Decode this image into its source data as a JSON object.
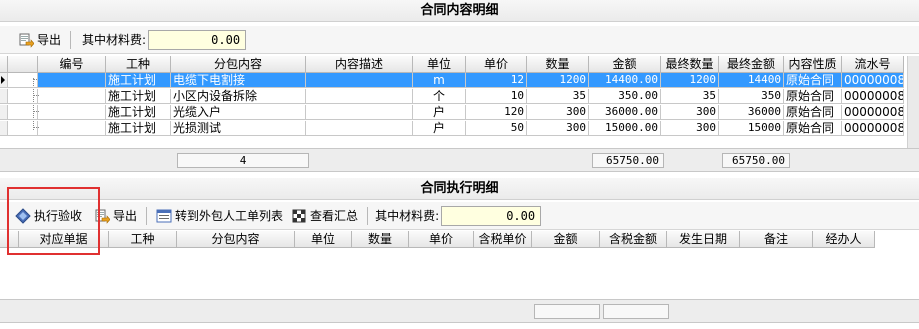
{
  "contract": {
    "title": "合同内容明细",
    "toolbar": {
      "export_label": "导出",
      "material_fee_label": "其中材料费:",
      "material_fee_value": "0.00"
    },
    "columns": [
      "编号",
      "工种",
      "分包内容",
      "内容描述",
      "单位",
      "单价",
      "数量",
      "金额",
      "最终数量",
      "最终金额",
      "内容性质",
      "流水号"
    ],
    "rows": [
      {
        "code": "",
        "trade": "施工计划",
        "content": "电缆下电割接",
        "desc": "",
        "unit": "m",
        "price": "12",
        "qty": "1200",
        "amount": "14400.00",
        "final_qty": "1200",
        "final_amount": "14400",
        "nature": "原始合同",
        "serial": "00000008"
      },
      {
        "code": "",
        "trade": "施工计划",
        "content": "小区内设备拆除",
        "desc": "",
        "unit": "个",
        "price": "10",
        "qty": "35",
        "amount": "350.00",
        "final_qty": "35",
        "final_amount": "350",
        "nature": "原始合同",
        "serial": "00000008"
      },
      {
        "code": "",
        "trade": "施工计划",
        "content": "光缆入户",
        "desc": "",
        "unit": "户",
        "price": "120",
        "qty": "300",
        "amount": "36000.00",
        "final_qty": "300",
        "final_amount": "36000",
        "nature": "原始合同",
        "serial": "00000008"
      },
      {
        "code": "",
        "trade": "施工计划",
        "content": "光损测试",
        "desc": "",
        "unit": "户",
        "price": "50",
        "qty": "300",
        "amount": "15000.00",
        "final_qty": "300",
        "final_amount": "15000",
        "nature": "原始合同",
        "serial": "00000008"
      }
    ],
    "footer": {
      "count": "4",
      "amount_total": "65750.00",
      "final_amount_total": "65750.00"
    }
  },
  "execution": {
    "title": "合同执行明细",
    "toolbar": {
      "accept_label": "执行验收",
      "export_label": "导出",
      "transfer_label": "转到外包人工单列表",
      "summary_label": "查看汇总",
      "material_fee_label": "其中材料费:",
      "material_fee_value": "0.00"
    },
    "columns": [
      "对应单据",
      "工种",
      "分包内容",
      "单位",
      "数量",
      "单价",
      "含税单价",
      "金额",
      "含税金额",
      "发生日期",
      "备注",
      "经办人"
    ]
  },
  "colors": {
    "selection": "#3399ff",
    "highlight_box": "#e03030",
    "input_bg": "#ffffe0"
  }
}
